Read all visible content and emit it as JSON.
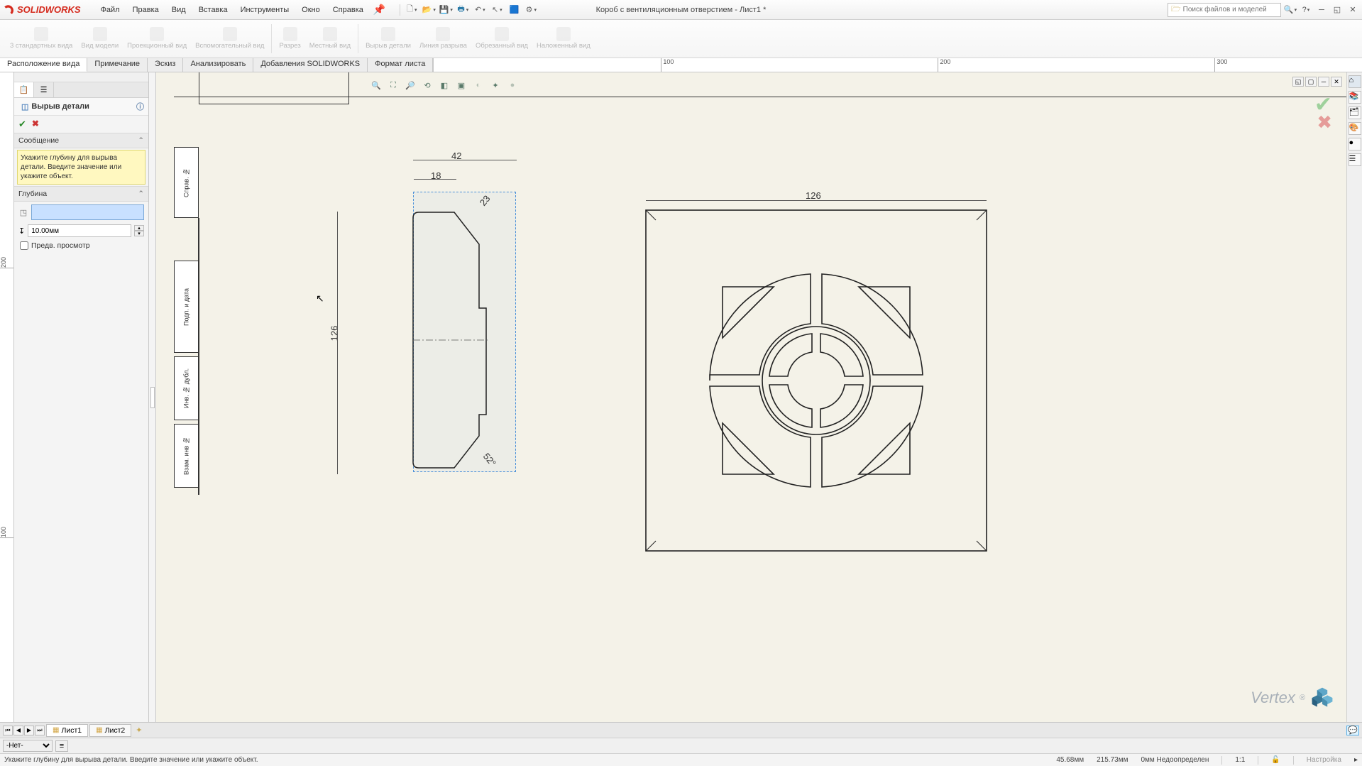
{
  "app": {
    "name": "SOLIDWORKS",
    "doc_title": "Короб с вентиляционным отверстием - Лист1 *"
  },
  "menu": {
    "file": "Файл",
    "edit": "Правка",
    "view": "Вид",
    "insert": "Вставка",
    "tools": "Инструменты",
    "window": "Окно",
    "help": "Справка"
  },
  "search": {
    "placeholder": "Поиск файлов и моделей"
  },
  "ribbon": {
    "items": [
      "3 стандартных вида",
      "Вид модели",
      "Проекционный вид",
      "Вспомогательный вид",
      "Разрез",
      "Местный вид",
      "Вырыв детали",
      "Линия разрыва",
      "Обрезанный вид",
      "Наложенный вид"
    ]
  },
  "cmtabs": {
    "layout": "Расположение вида",
    "annotate": "Примечание",
    "sketch": "Эскиз",
    "evaluate": "Анализировать",
    "addins": "Добавления SOLIDWORKS",
    "sheetfmt": "Формат листа"
  },
  "ruler_h": [
    "100",
    "200",
    "300"
  ],
  "ruler_v": [
    "200",
    "100"
  ],
  "pm": {
    "title": "Вырыв детали",
    "msg_header": "Сообщение",
    "msg": "Укажите глубину для вырыва детали. Введите значение или укажите объект.",
    "depth_header": "Глубина",
    "depth_value": "10.00мм",
    "preview": "Предв. просмотр"
  },
  "dims": {
    "d42": "42",
    "d18": "18",
    "d23": "23",
    "d126_v": "126",
    "d52": "52°",
    "d126_h": "126"
  },
  "sheets": {
    "sheet1": "Лист1",
    "sheet2": "Лист2"
  },
  "layer": {
    "none": "-Нет-"
  },
  "status": {
    "hint": "Укажите глубину для вырыва детали. Введите значение или укажите объект.",
    "x": "45.68мм",
    "y": "215.73мм",
    "z": "0мм",
    "state": "Недоопределен",
    "scale": "1:1",
    "custom": "Настройка"
  },
  "watermark": "Vertex",
  "titleblock": {
    "sprav": "Справ. №",
    "podp": "Подп. и дата",
    "inv": "Инв. № дубл.",
    "vzam": "Взам. инв №"
  }
}
